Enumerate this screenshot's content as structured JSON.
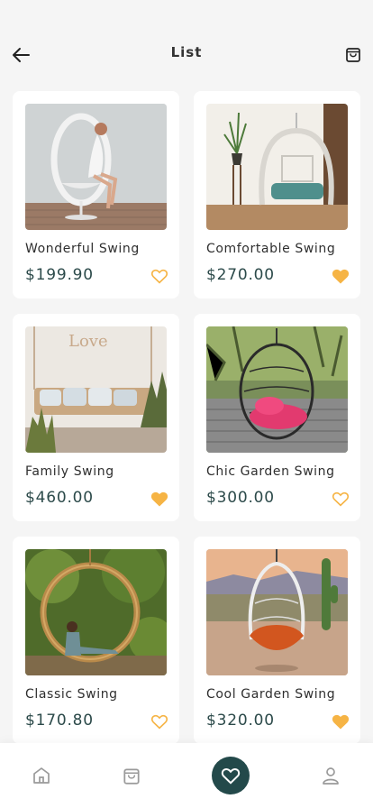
{
  "header": {
    "title": "List",
    "back_icon": "arrow-left-icon",
    "cart_icon": "shopping-bag-icon"
  },
  "colors": {
    "accent": "#23494a",
    "favorite": "#f6b445",
    "price": "#2c4a4a",
    "background": "#f5f5f5"
  },
  "products": [
    {
      "name": "Wonderful Swing",
      "price": "$199.90",
      "favorite": false
    },
    {
      "name": "Comfortable Swing",
      "price": "$270.00",
      "favorite": true
    },
    {
      "name": "Family Swing",
      "price": "$460.00",
      "favorite": true
    },
    {
      "name": "Chic Garden Swing",
      "price": "$300.00",
      "favorite": false
    },
    {
      "name": "Classic Swing",
      "price": "$170.80",
      "favorite": false
    },
    {
      "name": "Cool Garden Swing",
      "price": "$320.00",
      "favorite": true
    }
  ],
  "tabbar": {
    "items": [
      {
        "icon": "home-icon",
        "active": false
      },
      {
        "icon": "shopping-bag-icon",
        "active": false
      },
      {
        "icon": "heart-icon",
        "active": true
      },
      {
        "icon": "user-icon",
        "active": false
      }
    ]
  }
}
